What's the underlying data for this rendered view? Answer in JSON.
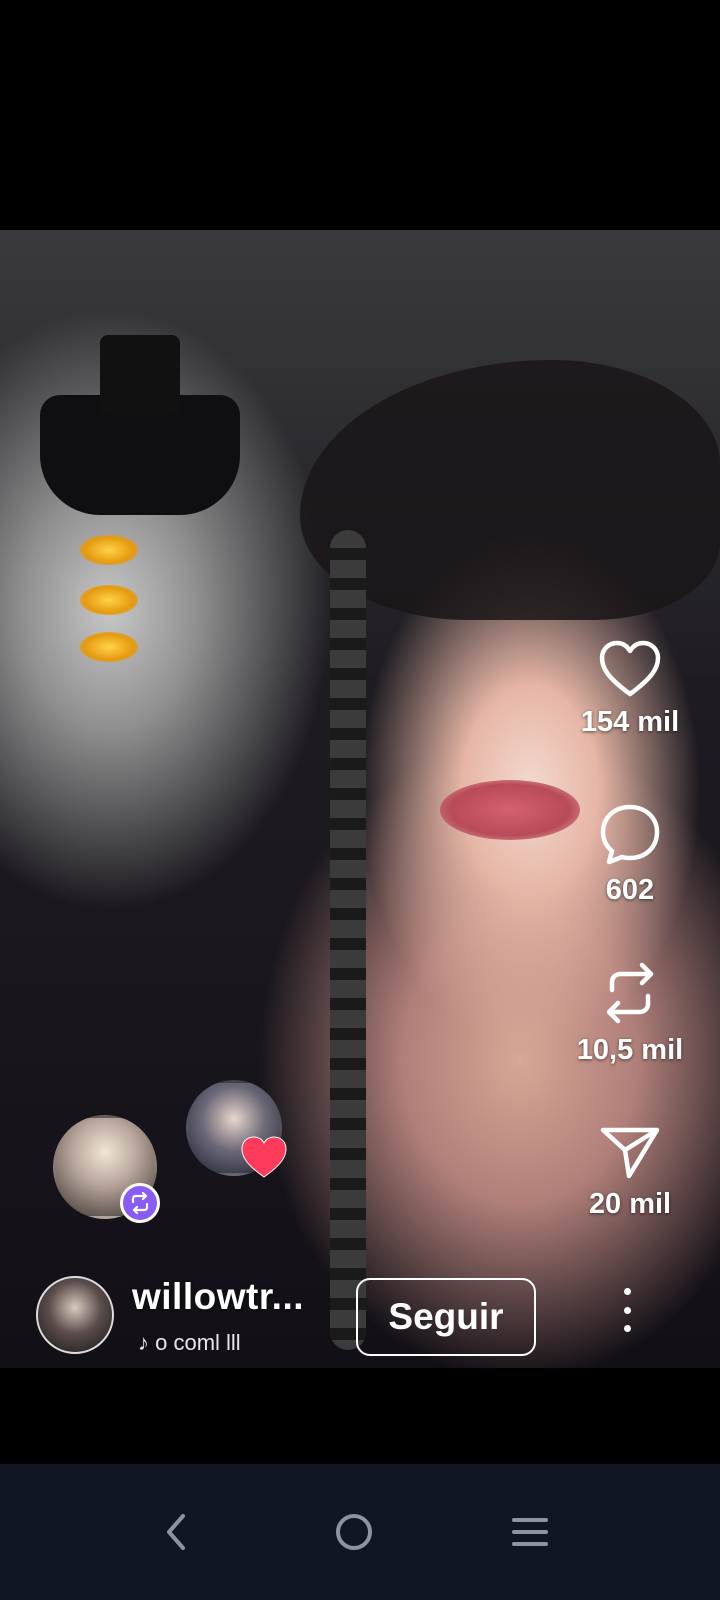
{
  "video": {
    "actions": {
      "like": {
        "icon": "heart-icon",
        "count": "154 mil"
      },
      "comment": {
        "icon": "comment-bubble-icon",
        "count": "602"
      },
      "repost": {
        "icon": "repost-icon",
        "count": "10,5 mil"
      },
      "share": {
        "icon": "send-icon",
        "count": "20 mil"
      }
    },
    "friend_activity": {
      "repost_avatar_badge": "repost-icon",
      "like_avatar_badge": "heart-icon"
    },
    "author": {
      "username": "willowtr...",
      "music": "♪ o  coml lll",
      "follow_label": "Seguir"
    }
  },
  "system_nav": {
    "back": "back-chevron-icon",
    "home": "home-circle-icon",
    "recents": "recents-lines-icon"
  },
  "colors": {
    "repost_badge": "#8a5cf6",
    "heart_badge": "#ff3b5c",
    "navbar_bg": "#111722"
  }
}
